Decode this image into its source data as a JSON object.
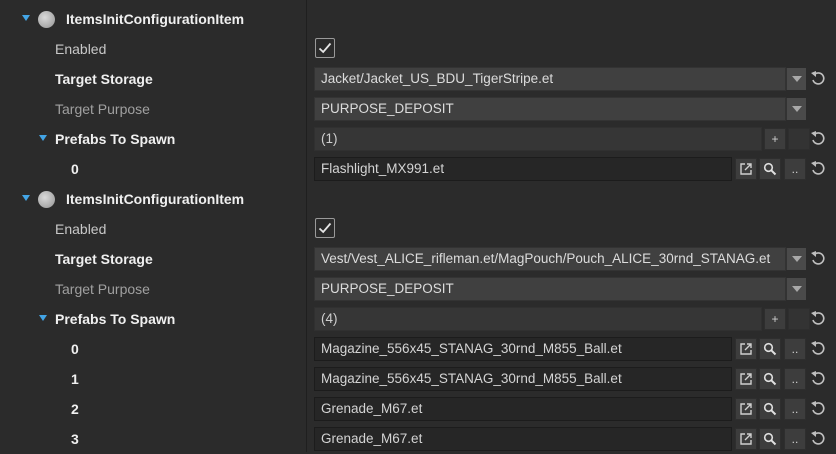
{
  "items": [
    {
      "title": "ItemsInitConfigurationItem",
      "enabled_label": "Enabled",
      "storage_label": "Target Storage",
      "storage_value": "Jacket/Jacket_US_BDU_TigerStripe.et",
      "purpose_label": "Target Purpose",
      "purpose_value": "PURPOSE_DEPOSIT",
      "prefabs_label": "Prefabs To Spawn",
      "prefabs_count": "(1)",
      "prefabs": [
        {
          "index": "0",
          "value": "Flashlight_MX991.et"
        }
      ]
    },
    {
      "title": "ItemsInitConfigurationItem",
      "enabled_label": "Enabled",
      "storage_label": "Target Storage",
      "storage_value": "Vest/Vest_ALICE_rifleman.et/MagPouch/Pouch_ALICE_30rnd_STANAG.et",
      "purpose_label": "Target Purpose",
      "purpose_value": "PURPOSE_DEPOSIT",
      "prefabs_label": "Prefabs To Spawn",
      "prefabs_count": "(4)",
      "prefabs": [
        {
          "index": "0",
          "value": "Magazine_556x45_STANAG_30rnd_M855_Ball.et"
        },
        {
          "index": "1",
          "value": "Magazine_556x45_STANAG_30rnd_M855_Ball.et"
        },
        {
          "index": "2",
          "value": "Grenade_M67.et"
        },
        {
          "index": "3",
          "value": "Grenade_M67.et"
        }
      ]
    }
  ],
  "buttons": {
    "add_label": "+",
    "browse_label": ".."
  },
  "icons": {
    "expand": "chevron-down-icon",
    "entity": "sphere-icon",
    "check": "checkmark-icon",
    "dropdown": "dropdown-arrow-icon",
    "open": "open-external-icon",
    "search": "magnifier-icon",
    "reset": "reset-arrow-icon"
  },
  "colors": {
    "accent": "#43a5e6",
    "background": "#2b2b2b"
  }
}
